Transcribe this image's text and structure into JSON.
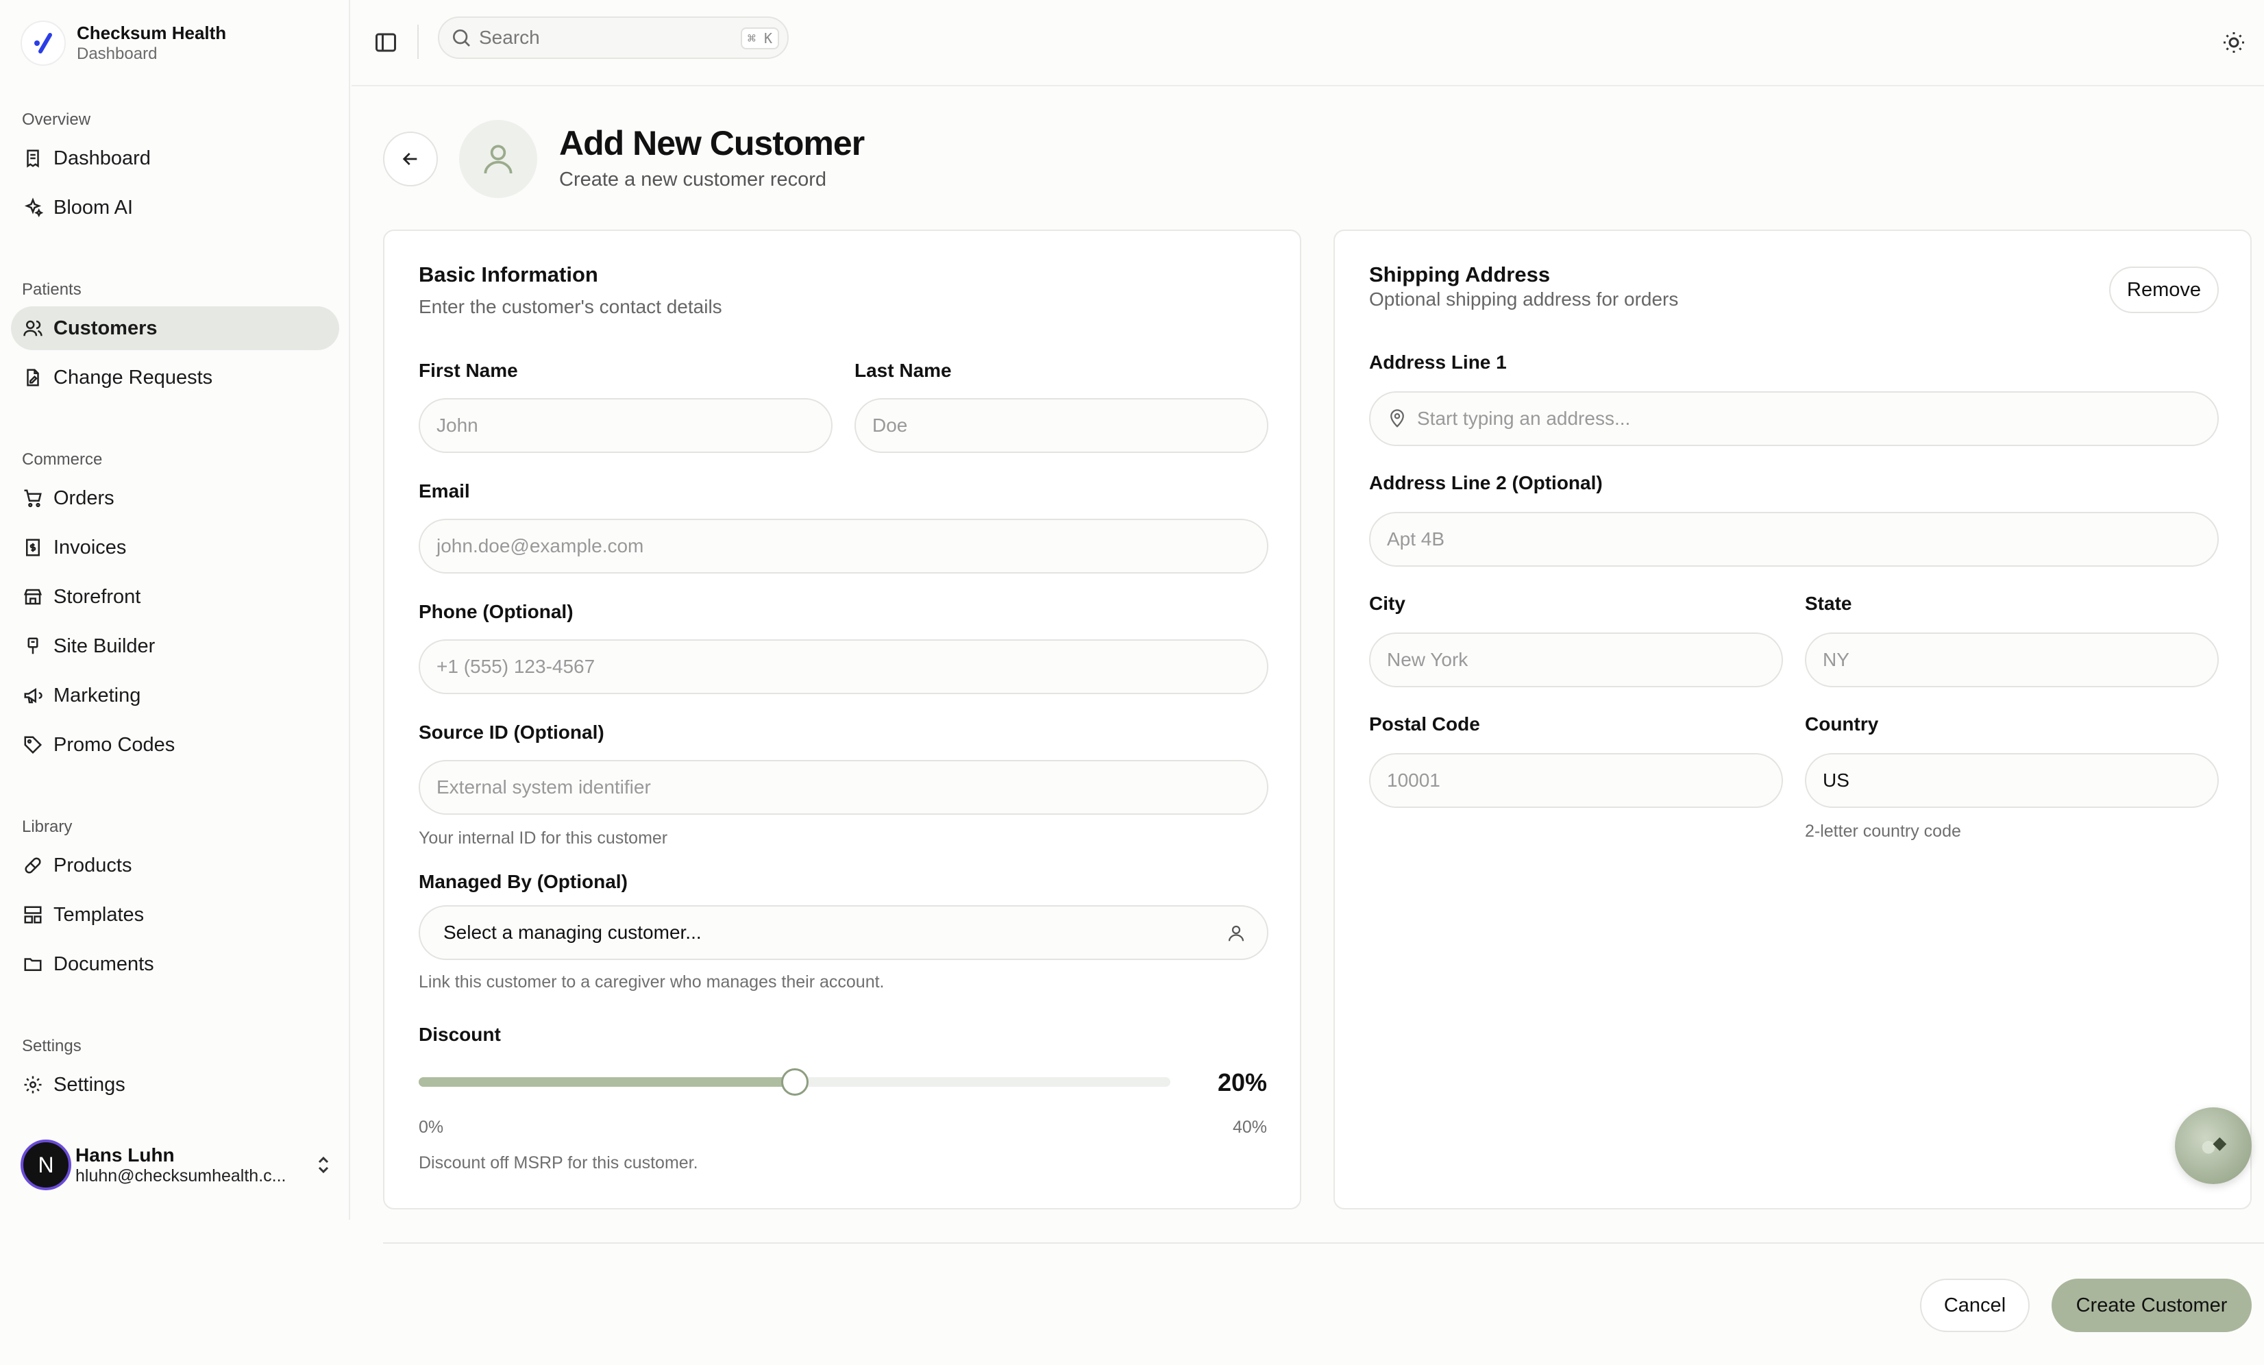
{
  "brand": {
    "name": "Checksum Health",
    "sub": "Dashboard"
  },
  "nav": {
    "overview": {
      "title": "Overview",
      "items": [
        "Dashboard",
        "Bloom AI"
      ]
    },
    "patients": {
      "title": "Patients",
      "items": [
        "Customers",
        "Change Requests"
      ]
    },
    "commerce": {
      "title": "Commerce",
      "items": [
        "Orders",
        "Invoices",
        "Storefront",
        "Site Builder",
        "Marketing",
        "Promo Codes"
      ]
    },
    "library": {
      "title": "Library",
      "items": [
        "Products",
        "Templates",
        "Documents"
      ]
    },
    "settings": {
      "title": "Settings",
      "items": [
        "Settings"
      ]
    }
  },
  "user": {
    "initial": "N",
    "name": "Hans Luhn",
    "email": "hluhn@checksumhealth.c..."
  },
  "search": {
    "placeholder": "Search",
    "kbd": "⌘ K"
  },
  "header": {
    "title": "Add New Customer",
    "subtitle": "Create a new customer record"
  },
  "basic": {
    "title": "Basic Information",
    "desc": "Enter the customer's contact details",
    "first_name_label": "First Name",
    "first_name_placeholder": "John",
    "last_name_label": "Last Name",
    "last_name_placeholder": "Doe",
    "email_label": "Email",
    "email_placeholder": "john.doe@example.com",
    "phone_label": "Phone (Optional)",
    "phone_placeholder": "+1 (555) 123-4567",
    "source_label": "Source ID (Optional)",
    "source_placeholder": "External system identifier",
    "source_hint": "Your internal ID for this customer",
    "managed_label": "Managed By (Optional)",
    "managed_value": "Select a managing customer...",
    "managed_hint": "Link this customer to a caregiver who manages their account.",
    "discount_label": "Discount",
    "discount_value": "20%",
    "discount_fraction": 0.5,
    "discount_min": "0%",
    "discount_max": "40%",
    "discount_hint": "Discount off MSRP for this customer."
  },
  "shipping": {
    "title": "Shipping Address",
    "desc": "Optional shipping address for orders",
    "remove": "Remove",
    "addr1_label": "Address Line 1",
    "addr1_placeholder": "Start typing an address...",
    "addr2_label": "Address Line 2 (Optional)",
    "addr2_placeholder": "Apt 4B",
    "city_label": "City",
    "city_placeholder": "New York",
    "state_label": "State",
    "state_placeholder": "NY",
    "postal_label": "Postal Code",
    "postal_placeholder": "10001",
    "country_label": "Country",
    "country_value": "US",
    "country_hint": "2-letter country code"
  },
  "actions": {
    "cancel": "Cancel",
    "create": "Create Customer"
  },
  "colors": {
    "accent": "#a9b69c",
    "active_nav": "#e6e9e3",
    "brand_logo": "#2b3ee6"
  }
}
